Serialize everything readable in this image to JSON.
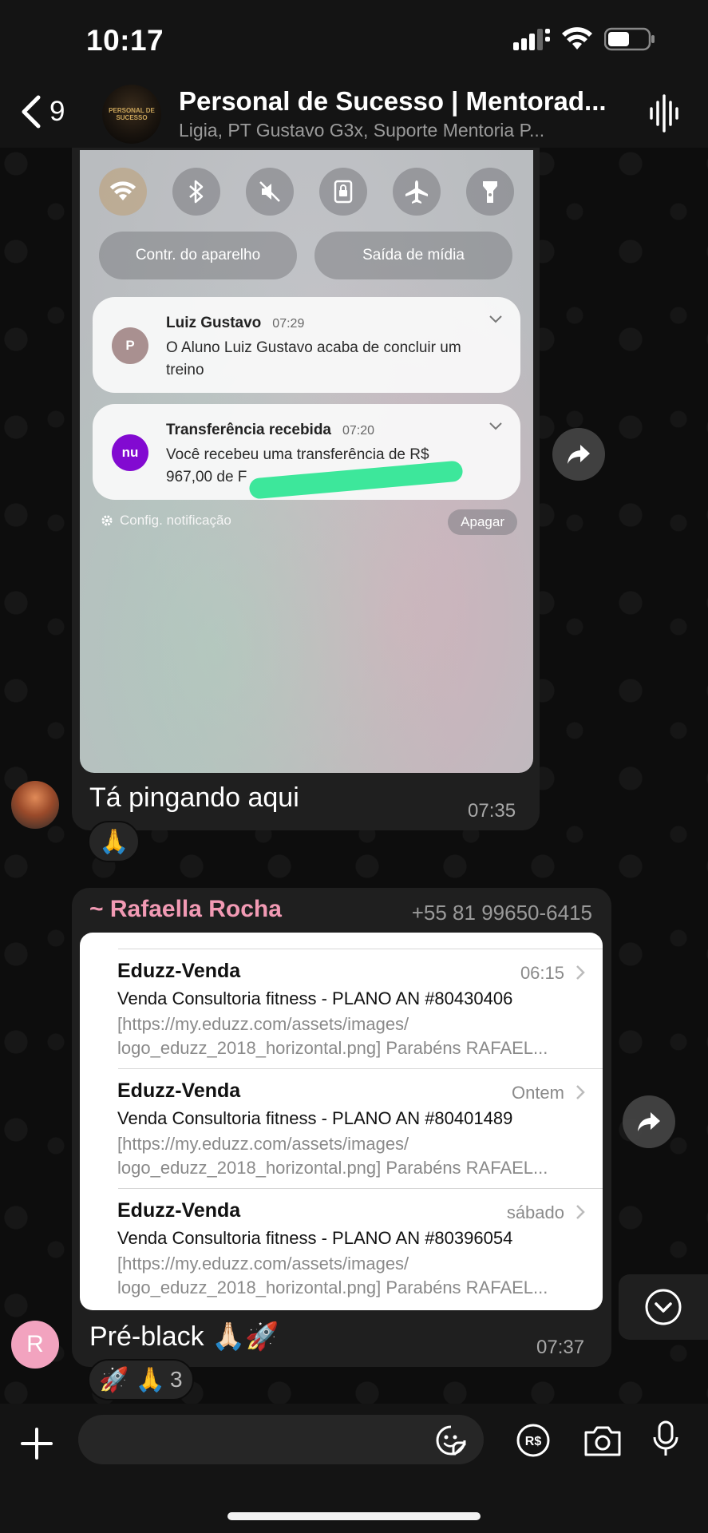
{
  "status_bar": {
    "time": "10:17"
  },
  "header": {
    "back_count": "9",
    "group_title": "Personal de Sucesso | Mentorad...",
    "group_subtitle": "Ligia, PT Gustavo G3x, Suporte Mentoria P...",
    "avatar_text": "PERSONAL DE SUCESSO"
  },
  "message1": {
    "screenshot": {
      "pills": [
        "Contr. do aparelho",
        "Saída de mídia"
      ],
      "notifications": [
        {
          "icon_text": "P",
          "icon_color": "#a99090",
          "title": "Luiz Gustavo",
          "time": "07:29",
          "body": "O Aluno Luiz Gustavo  acaba de concluir um treino"
        },
        {
          "icon_text": "nu",
          "icon_color": "#820ad1",
          "title": "Transferência recebida",
          "time": "07:20",
          "body": "Você recebeu uma transferência de R$ 967,00 de F"
        }
      ],
      "settings_label": "Config. notificação",
      "clear_label": "Apagar"
    },
    "text": "Tá pingando aqui",
    "time": "07:35",
    "reaction": "🙏"
  },
  "message2": {
    "sender_name": "~ Rafaella Rocha",
    "sender_phone": "+55 81 99650-6415",
    "mails": [
      {
        "from": "Eduzz-Venda",
        "date": "06:15",
        "subject": "Venda Consultoria fitness - PLANO AN #80430406",
        "preview": "[https://my.eduzz.com/assets/images/ logo_eduzz_2018_horizontal.png] Parabéns RAFAEL..."
      },
      {
        "from": "Eduzz-Venda",
        "date": "Ontem",
        "subject": "Venda Consultoria fitness - PLANO AN #80401489",
        "preview": "[https://my.eduzz.com/assets/images/ logo_eduzz_2018_horizontal.png] Parabéns RAFAEL..."
      },
      {
        "from": "Eduzz-Venda",
        "date": "sábado",
        "subject": "Venda Consultoria fitness - PLANO AN #80396054",
        "preview": "[https://my.eduzz.com/assets/images/ logo_eduzz_2018_horizontal.png] Parabéns RAFAEL..."
      }
    ],
    "text": "Pré-black 🙏🏻🚀",
    "time": "07:37",
    "avatar_letter": "R",
    "avatar_color": "#f2a3bf",
    "reactions": "🚀 🙏",
    "reaction_count": "3"
  },
  "input_bar": {
    "placeholder": "",
    "pix_label": "R$"
  },
  "colors": {
    "sender_name": "#f29ab4",
    "highlight": "#3de79b",
    "bubble": "#1f1f1f"
  }
}
